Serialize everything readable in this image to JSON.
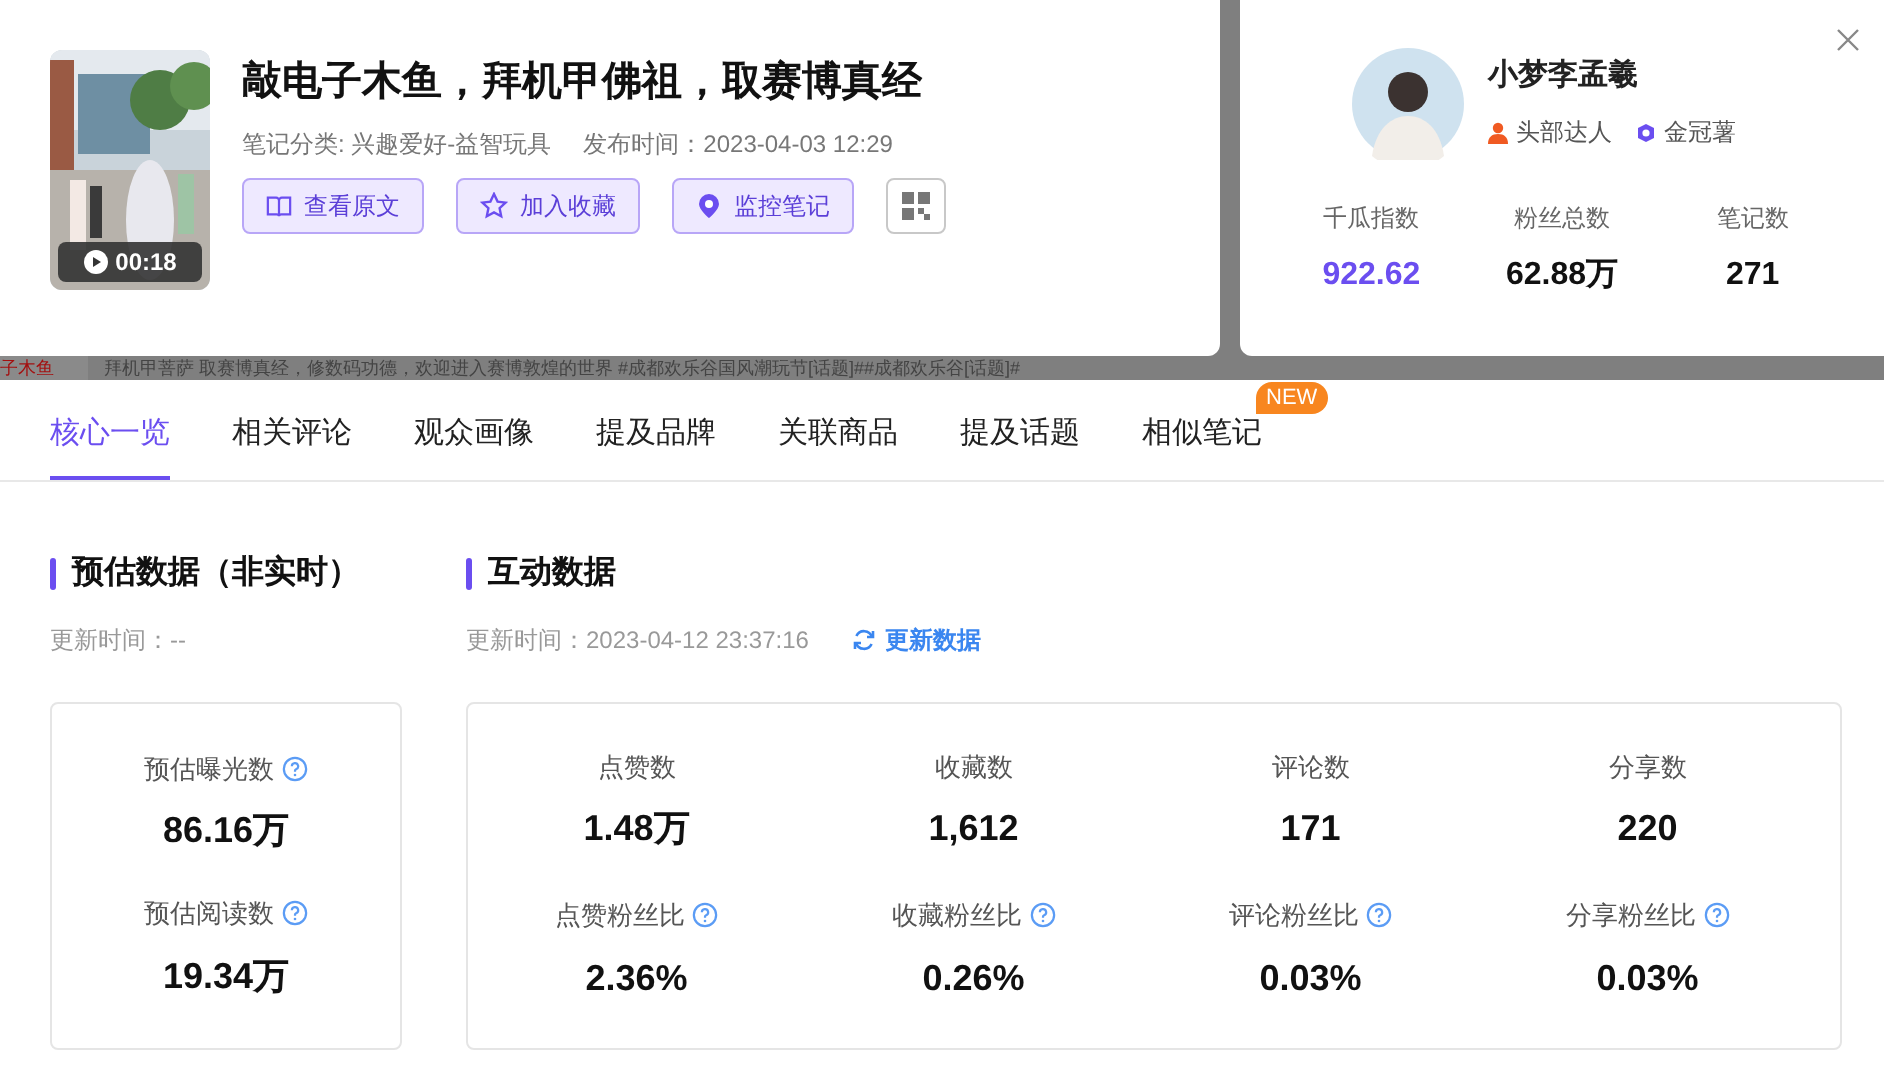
{
  "note": {
    "title": "敲电子木鱼，拜机甲佛祖，取赛博真经",
    "duration": "00:18",
    "category": "笔记分类: 兴趣爱好-益智玩具",
    "published": "发布时间：2023-04-03 12:29",
    "actions": [
      {
        "kind": "book",
        "label": "查看原文"
      },
      {
        "kind": "star",
        "label": "加入收藏"
      },
      {
        "kind": "pin",
        "label": "监控笔记"
      },
      {
        "kind": "qr"
      }
    ]
  },
  "author": {
    "name": "小梦李孟羲",
    "badges": [
      {
        "kind": "person",
        "label": "头部达人"
      },
      {
        "kind": "crown",
        "label": "金冠薯"
      }
    ],
    "stats": [
      {
        "label": "千瓜指数",
        "value": "922.62",
        "highlight": true
      },
      {
        "label": "粉丝总数",
        "value": "62.88万",
        "highlight": false
      },
      {
        "label": "笔记数",
        "value": "271",
        "highlight": false
      }
    ]
  },
  "background_strip": {
    "left": "子木鱼",
    "text": "拜机甲菩萨 取赛博真经，修数码功德，欢迎进入赛博敦煌的世界 #成都欢乐谷国风潮玩节[话题]##成都欢乐谷[话题]#"
  },
  "tabs": [
    {
      "label": "核心一览",
      "selected": true
    },
    {
      "label": "相关评论",
      "selected": false
    },
    {
      "label": "观众画像",
      "selected": false
    },
    {
      "label": "提及品牌",
      "selected": false
    },
    {
      "label": "关联商品",
      "selected": false
    },
    {
      "label": "提及话题",
      "selected": false
    },
    {
      "label": "相似笔记",
      "selected": false,
      "badge": "NEW"
    }
  ],
  "estimate": {
    "title": "预估数据（非实时）",
    "updated": "更新时间：--",
    "metrics": [
      {
        "label": "预估曝光数",
        "value": "86.16万"
      },
      {
        "label": "预估阅读数",
        "value": "19.34万"
      }
    ]
  },
  "interaction": {
    "title": "互动数据",
    "updated": "更新时间：2023-04-12 23:37:16",
    "refresh": "更新数据",
    "metrics": [
      {
        "label": "点赞数",
        "value": "1.48万",
        "help": false
      },
      {
        "label": "收藏数",
        "value": "1,612",
        "help": false
      },
      {
        "label": "评论数",
        "value": "171",
        "help": false
      },
      {
        "label": "分享数",
        "value": "220",
        "help": false
      },
      {
        "label": "点赞粉丝比",
        "value": "2.36%",
        "help": true
      },
      {
        "label": "收藏粉丝比",
        "value": "0.26%",
        "help": true
      },
      {
        "label": "评论粉丝比",
        "value": "0.03%",
        "help": true
      },
      {
        "label": "分享粉丝比",
        "value": "0.03%",
        "help": true
      }
    ]
  }
}
